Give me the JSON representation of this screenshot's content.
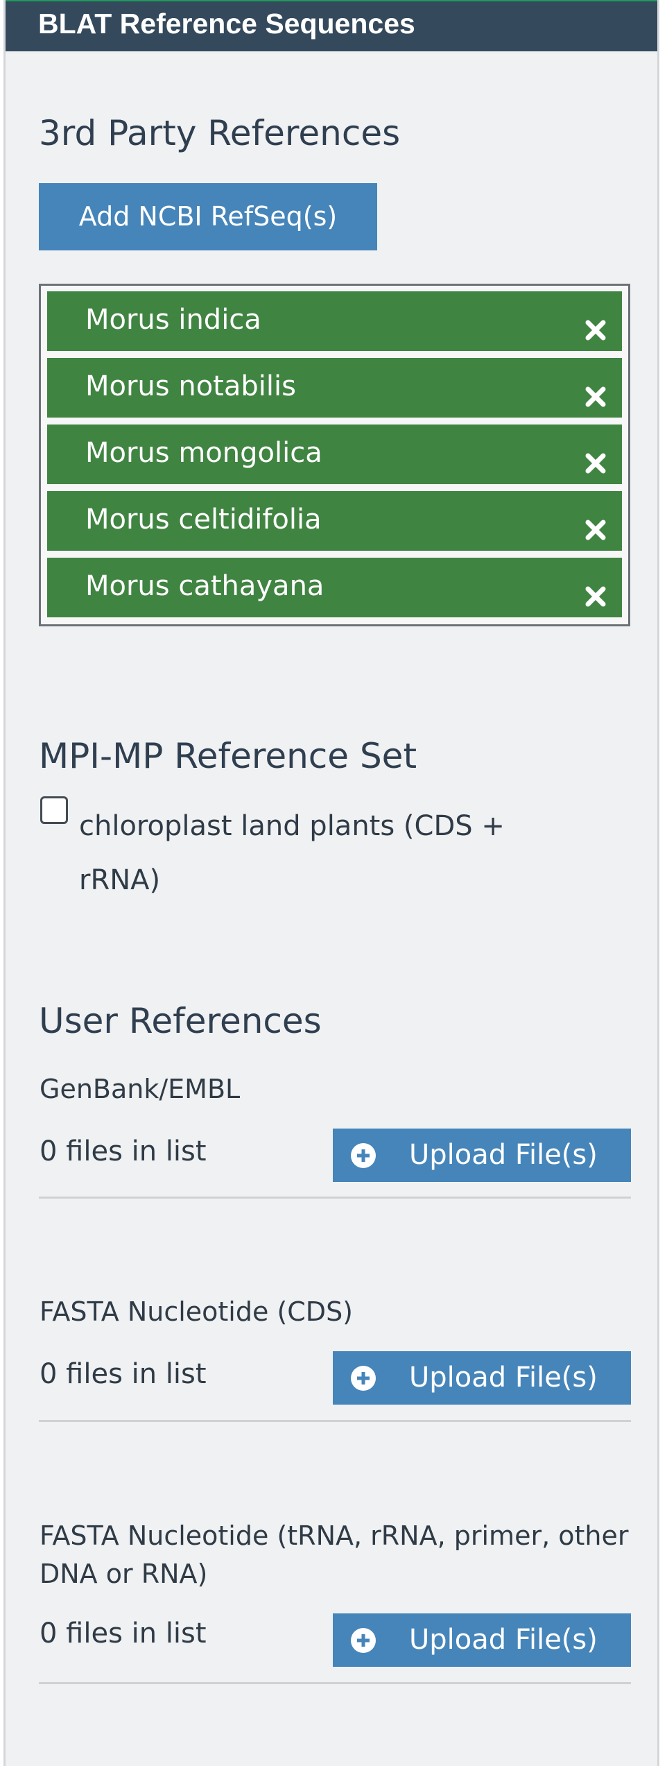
{
  "panel": {
    "title": "BLAT Reference Sequences"
  },
  "third_party": {
    "heading": "3rd Party References",
    "add_button_label": "Add NCBI RefSeq(s)",
    "references": [
      {
        "name": "Morus indica"
      },
      {
        "name": "Morus notabilis"
      },
      {
        "name": "Morus mongolica"
      },
      {
        "name": "Morus celtidifolia"
      },
      {
        "name": "Morus cathayana"
      }
    ],
    "item_color": "#408442"
  },
  "mpi_mp": {
    "heading": "MPI-MP Reference Set",
    "option_label": "chloroplast land plants (CDS + rRNA)",
    "option_checked": false
  },
  "user_references": {
    "heading": "User References",
    "groups": [
      {
        "label": "GenBank/EMBL",
        "count_text": "0 files in list",
        "upload_label": "Upload File(s)"
      },
      {
        "label": "FASTA Nucleotide (CDS)",
        "count_text": "0 files in list",
        "upload_label": "Upload File(s)"
      },
      {
        "label": "FASTA Nucleotide (tRNA, rRNA, primer, other DNA or RNA)",
        "count_text": "0 files in list",
        "upload_label": "Upload File(s)"
      }
    ]
  },
  "colors": {
    "header_bg": "#34495c",
    "button_blue": "#4585ba",
    "panel_bg": "#f0f1f3"
  },
  "icons": {
    "remove": "close-icon",
    "upload": "plus-circle-icon"
  }
}
